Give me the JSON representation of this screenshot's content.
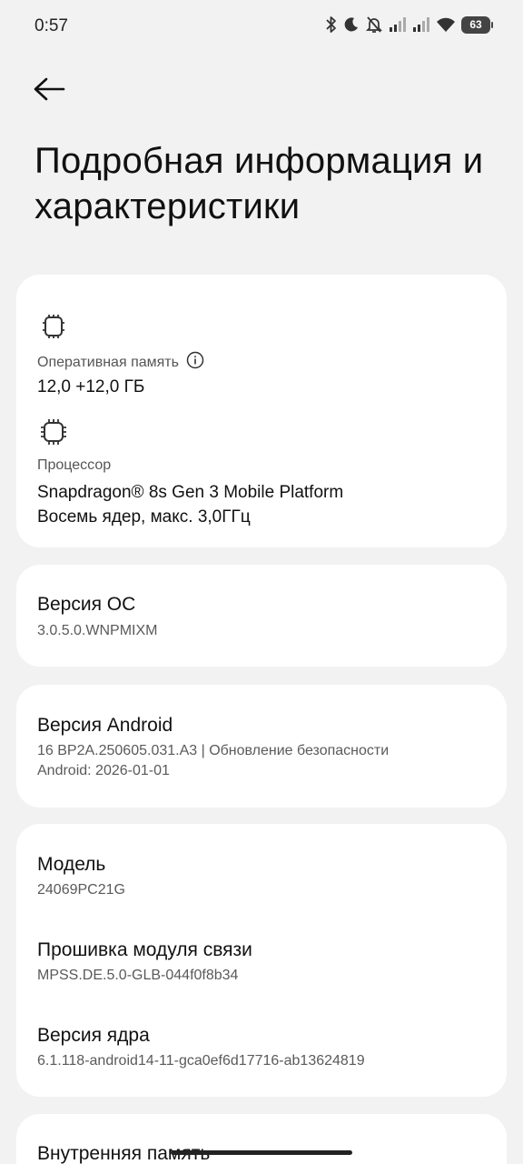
{
  "status_bar": {
    "time": "0:57",
    "battery": "63",
    "icons": [
      "bluetooth-icon",
      "moon-icon",
      "bell-off-icon",
      "signal-icon",
      "signal-icon",
      "wifi-icon",
      "battery-icon"
    ]
  },
  "header": {
    "back_icon": "arrow-left-icon",
    "title": "Подробная информация и характеристики"
  },
  "hardware": {
    "ram": {
      "icon": "chip-icon",
      "label": "Оперативная память",
      "info_icon": "info-icon",
      "value": "12,0 +12,0 ГБ"
    },
    "cpu": {
      "icon": "processor-icon",
      "label": "Процессор",
      "line1": "Snapdragon® 8s Gen 3 Mobile Platform",
      "line2": "Восемь ядер, макс. 3,0ГГц"
    }
  },
  "os_version": {
    "title": "Версия ОС",
    "value": "3.0.5.0.WNPMIXM"
  },
  "android_version": {
    "title": "Версия Android",
    "line1": "16 BP2A.250605.031.A3 | Обновление безопасности",
    "line2": "Android: 2026-01-01"
  },
  "device_info": {
    "model_title": "Модель",
    "model_value": "24069PC21G",
    "baseband_title": "Прошивка модуля связи",
    "baseband_value": "MPSS.DE.5.0-GLB-044f0f8b34",
    "kernel_title": "Версия ядра",
    "kernel_value": "6.1.118-android14-11-gca0ef6d17716-ab13624819"
  },
  "storage": {
    "title": "Внутренняя память"
  },
  "colors": {
    "background": "#f2f2f2",
    "card": "#ffffff",
    "text_primary": "#111111",
    "text_secondary": "#5a5a5a"
  }
}
